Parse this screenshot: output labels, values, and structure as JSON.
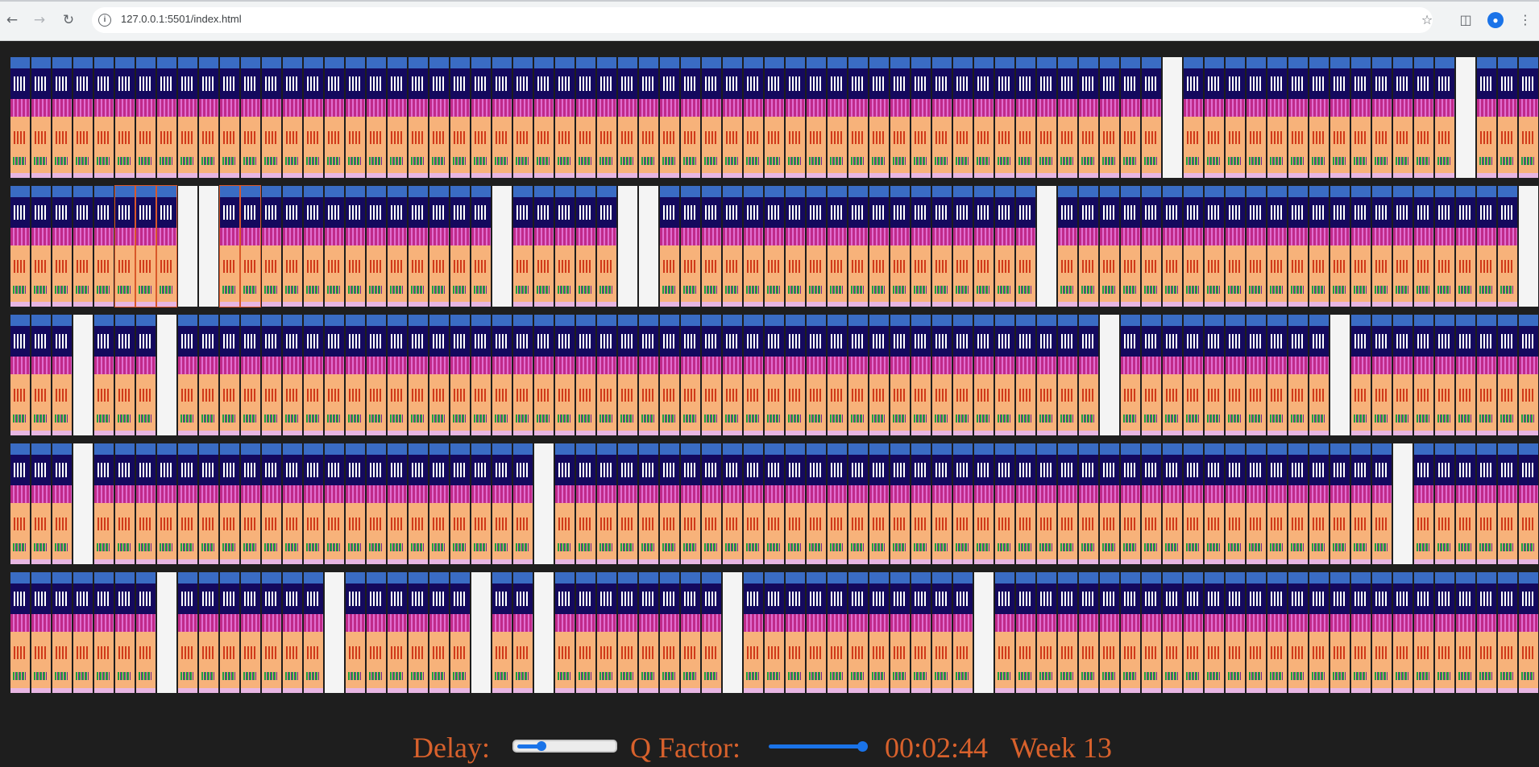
{
  "browser": {
    "url": "127.0.0.1:5501/index.html",
    "icons": [
      "back-arrow-icon",
      "forward-arrow-icon",
      "reload-icon",
      "site-info-icon",
      "star-icon",
      "side-panel-icon",
      "profile-icon",
      "menu-dots-icon"
    ]
  },
  "board": {
    "colors": {
      "top": "#3a6cc4",
      "navy": "#14095e",
      "magenta": "#c02a8a",
      "peach": "#f7b27a",
      "empty": "#f4f4f4",
      "selection": "#d8582a"
    },
    "rows": [
      {
        "empty": [
          55,
          69
        ],
        "selected": []
      },
      {
        "empty": [
          8,
          9,
          23,
          29,
          30,
          49,
          72
        ],
        "selected": [
          5,
          6,
          7,
          10,
          11
        ]
      },
      {
        "empty": [
          3,
          7,
          52,
          63
        ],
        "selected": []
      },
      {
        "empty": [
          3,
          25,
          66
        ],
        "selected": []
      },
      {
        "empty": [
          7,
          15,
          22,
          25,
          34,
          46
        ],
        "selected": []
      }
    ],
    "cells_per_row": 73
  },
  "controls": {
    "delay_label": "Delay:",
    "delay_value": 0.25,
    "q_factor_label": "Q Factor:",
    "q_factor_value": 1.0,
    "timer": "00:02:44",
    "week": "Week 13",
    "accent_color": "#d8612c"
  }
}
